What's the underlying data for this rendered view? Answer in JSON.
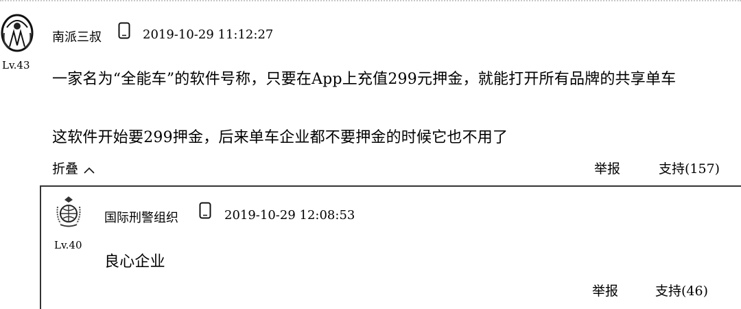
{
  "comment": {
    "username": "南派三叔",
    "level": "Lv.43",
    "device_icon": "phone-icon",
    "timestamp": "2019-10-29 11:12:27",
    "paragraphs": [
      "一家名为“全能车”的软件号称，只要在App上充值299元押金，就能打开所有品牌的共享单车",
      "这软件开始要299押金，后来单车企业都不要押金的时候它也不用了"
    ],
    "fold_label": "折叠",
    "fold_icon": "caret-up-icon",
    "report_label": "举报",
    "support_label": "支持(157)"
  },
  "reply": {
    "username": "国际刑警组织",
    "level": "Lv.40",
    "device_icon": "phone-icon",
    "timestamp": "2019-10-29 12:08:53",
    "text": "良心企业",
    "report_label": "举报",
    "support_label": "支持(46)"
  }
}
